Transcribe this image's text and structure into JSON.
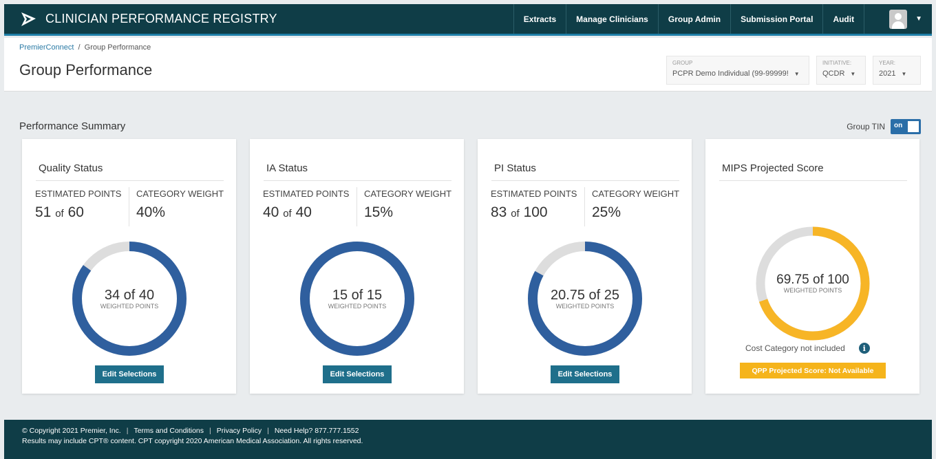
{
  "app": {
    "title": "CLINICIAN PERFORMANCE REGISTRY"
  },
  "nav": {
    "items": [
      "Extracts",
      "Manage Clinicians",
      "Group Admin",
      "Submission Portal",
      "Audit"
    ]
  },
  "breadcrumb": {
    "root": "PremierConnect",
    "separator": "/",
    "current": "Group Performance"
  },
  "page": {
    "title": "Group Performance"
  },
  "filters": {
    "group": {
      "label": "GROUP",
      "value": "PCPR Demo Individual (99-99999!"
    },
    "initiative": {
      "label": "INITIATIVE:",
      "value": "QCDR"
    },
    "year": {
      "label": "YEAR:",
      "value": "2021"
    }
  },
  "summary": {
    "title": "Performance Summary",
    "group_tin_label": "Group TIN",
    "group_tin_toggle": "on"
  },
  "labels": {
    "estimated_points": "ESTIMATED POINTS",
    "category_weight": "CATEGORY WEIGHT",
    "weighted_points": "WEIGHTED POINTS",
    "of": "of",
    "edit": "Edit Selections"
  },
  "cards": [
    {
      "title": "Quality Status",
      "est_value": "51",
      "est_total": "60",
      "weight": "40%",
      "donut_text": "34 of 40",
      "earned": 34,
      "max": 40
    },
    {
      "title": "IA Status",
      "est_value": "40",
      "est_total": "40",
      "weight": "15%",
      "donut_text": "15 of 15",
      "earned": 15,
      "max": 15
    },
    {
      "title": "PI Status",
      "est_value": "83",
      "est_total": "100",
      "weight": "25%",
      "donut_text": "20.75 of 25",
      "earned": 20.75,
      "max": 25
    }
  ],
  "mips": {
    "title": "MIPS Projected Score",
    "donut_text": "69.75 of 100",
    "earned": 69.75,
    "max": 100,
    "cost_note": "Cost Category not included",
    "qpp_badge": "QPP Projected Score: Not Available"
  },
  "colors": {
    "nav_bg": "#0f3d47",
    "donut_blue": "#2f5f9e",
    "donut_track": "#dddddd",
    "mips_yellow": "#f7b526",
    "button": "#1f6f8b",
    "badge": "#f5b41b"
  },
  "icons": {
    "logo": "premier-logo-icon",
    "user": "user-avatar-icon",
    "chevron": "chevron-down-icon",
    "info": "info-icon"
  },
  "footer": {
    "copyright": "© Copyright 2021 Premier, Inc.",
    "terms": "Terms and Conditions",
    "privacy": "Privacy Policy",
    "help": "Need Help? 877.777.1552",
    "cpt_note": "Results may include CPT® content. CPT copyright 2020 American Medical Association. All rights reserved."
  }
}
